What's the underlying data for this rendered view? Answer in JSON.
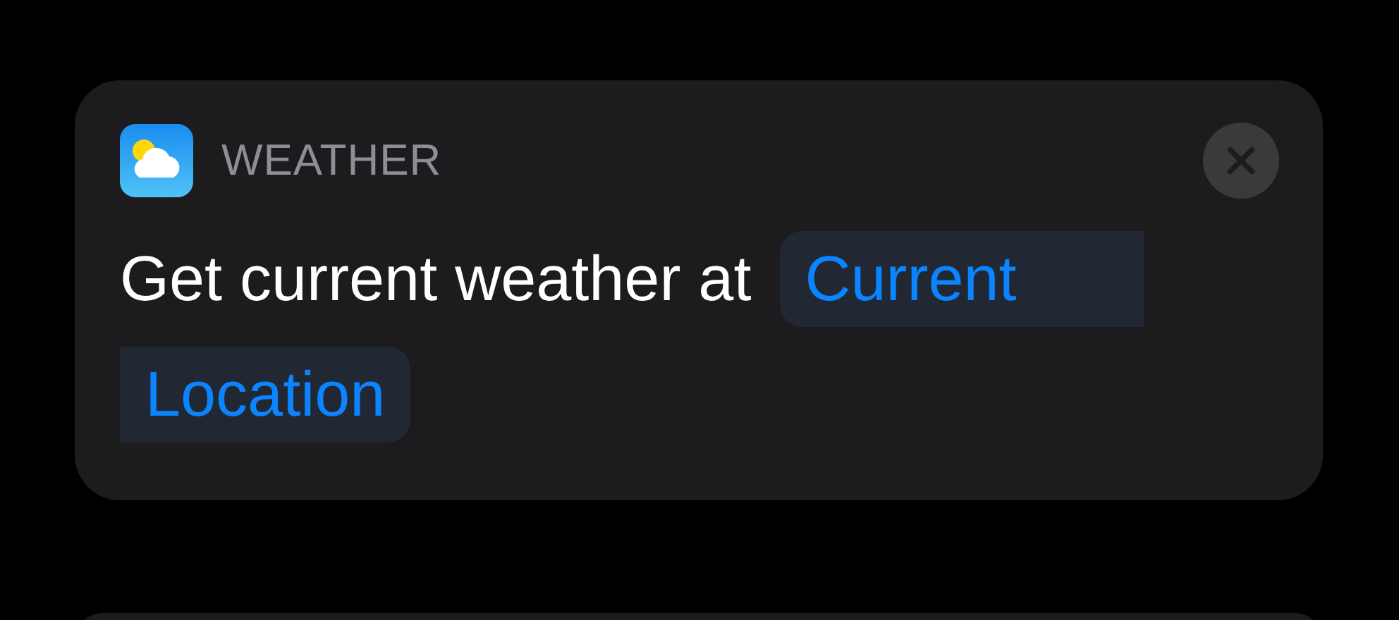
{
  "action": {
    "app": "WEATHER",
    "text": "Get current weather at",
    "parameter_lines": [
      "Current",
      "Location"
    ]
  }
}
